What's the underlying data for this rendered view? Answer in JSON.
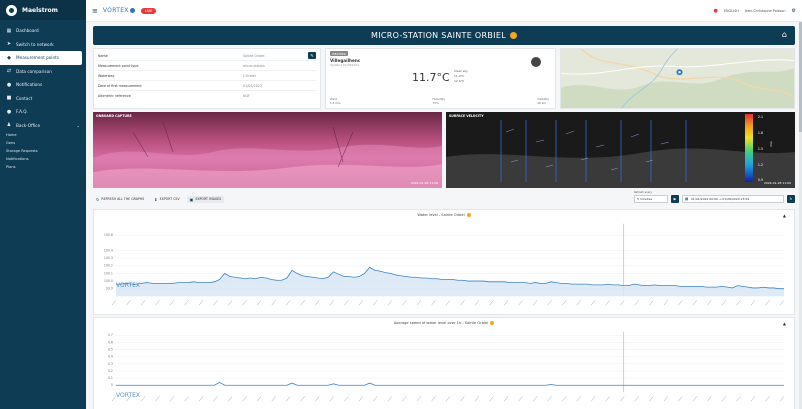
{
  "app": {
    "brand": "Maelstrom"
  },
  "sidebar": {
    "items": [
      {
        "label": "Dashboard",
        "icon": "grid-icon"
      },
      {
        "label": "Switch to network",
        "icon": "arrow-icon"
      },
      {
        "label": "Measurement points",
        "icon": "pin-icon"
      },
      {
        "label": "Data comparison",
        "icon": "compare-icon"
      },
      {
        "label": "Notifications",
        "icon": "bell-icon"
      },
      {
        "label": "Contact",
        "icon": "mail-icon"
      },
      {
        "label": "F.A.Q.",
        "icon": "help-icon"
      },
      {
        "label": "Back-Office",
        "icon": "settings-icon"
      }
    ],
    "sub_items": [
      "Home",
      "Gens",
      "Storage Requests",
      "Notifications",
      "Plans"
    ]
  },
  "topbar": {
    "logo_text": "VORTEX",
    "live_badge": "LIVE",
    "lang": "ENGLISH",
    "user": "Jean-Christophe Poisson"
  },
  "station": {
    "title": "MICRO-STATION SAINTE ORBIEL"
  },
  "info": {
    "rows": [
      {
        "key": "Name",
        "value": "Sainte Orbiel"
      },
      {
        "key": "Measurement point type",
        "value": "micro-station"
      },
      {
        "key": "Waterway",
        "value": "L'Orbiel"
      },
      {
        "key": "Date of first measurement",
        "value": "01/05/2023"
      },
      {
        "key": "Altimetric reference",
        "value": "NGF"
      }
    ]
  },
  "weather": {
    "tag": "WEATHER",
    "city": "Villegailhenc",
    "date": "Updated 01/28/2024",
    "temperature": "11.7°C",
    "condition_lines": [
      "Clear sky",
      "11.0°C",
      "12.0°C"
    ],
    "footer": [
      {
        "label": "Wind",
        "value": "1.5 m/s"
      },
      {
        "label": "Humidity",
        "value": "75%"
      },
      {
        "label": "Visibility",
        "value": "10 km"
      }
    ]
  },
  "media": {
    "cam_label": "ONBOARD CAPTURE",
    "cam_timestamp": "2024-01-28 11:00",
    "vel_label": "SURFACE VELOCITY",
    "vel_timestamp": "2024-01-28 11:00",
    "scale": [
      "2.1",
      "1.8",
      "1.5",
      "1.2",
      "0.9"
    ],
    "scale_unit": "m/s"
  },
  "toolbar": {
    "refresh": "REFRESH ALL THE GRAPHS",
    "export_csv": "EXPORT CSV",
    "export_images": "EXPORT IMAGES",
    "refresh_every_label": "Refresh every",
    "refresh_every_value": "5 minutes",
    "date_range": "01/01/2024 00:00 → 01/28/2024 23:59"
  },
  "chart_data": [
    {
      "type": "area",
      "title": "Water level - Sainte Orbiel",
      "ylim": [
        99.8,
        100.75
      ],
      "y_ticks": [
        "100.6",
        "100.4",
        "100.3",
        "100.2",
        "100.1",
        "100.0",
        "99.9"
      ],
      "values": [
        99.96,
        99.96,
        99.97,
        99.96,
        99.96,
        99.97,
        99.98,
        99.97,
        99.97,
        99.97,
        99.97,
        99.97,
        99.98,
        99.98,
        99.98,
        99.99,
        99.98,
        99.98,
        99.98,
        99.99,
        100.02,
        100.1,
        100.06,
        100.05,
        100.04,
        100.03,
        100.04,
        100.03,
        100.05,
        100.04,
        100.02,
        100.01,
        100.01,
        100.04,
        100.14,
        100.1,
        100.07,
        100.06,
        100.05,
        100.04,
        100.03,
        100.05,
        100.12,
        100.09,
        100.06,
        100.06,
        100.05,
        100.06,
        100.1,
        100.18,
        100.14,
        100.13,
        100.11,
        100.1,
        100.08,
        100.07,
        100.06,
        100.05,
        100.05,
        100.04,
        100.04,
        100.03,
        100.03,
        100.02,
        100.02,
        100.02,
        100.01,
        100.01,
        100.0,
        100.0,
        100.0,
        100.0,
        99.99,
        99.99,
        99.99,
        99.99,
        99.98,
        99.98,
        99.98,
        99.98,
        99.97,
        99.98,
        99.97,
        99.97,
        99.99,
        99.98,
        99.97,
        99.97,
        99.96,
        99.96,
        99.96,
        99.96,
        99.95,
        99.95,
        99.95,
        99.96,
        99.95,
        99.95,
        99.94,
        99.94,
        99.96,
        99.95,
        99.94,
        99.94,
        99.95,
        99.94,
        99.94,
        99.94,
        99.94,
        99.93,
        99.93,
        99.93,
        99.93,
        99.93,
        99.92,
        99.92,
        99.92,
        99.93,
        99.92,
        99.91,
        99.94,
        99.93,
        99.92,
        99.91,
        99.91,
        99.92,
        99.91,
        99.91,
        99.9,
        99.9
      ]
    },
    {
      "type": "line",
      "title": "Average speed of water level over 1h - Sainte Orbiel",
      "ylim": [
        -0.1,
        0.75
      ],
      "y_ticks": [
        "0.7",
        "0.6",
        "0.5",
        "0.4",
        "0.3",
        "0.2",
        "0.1",
        "0"
      ],
      "values": [
        0,
        0,
        0,
        0,
        0,
        0,
        0,
        0,
        0,
        0,
        0,
        0,
        0,
        0,
        0,
        0,
        0,
        0,
        0,
        0,
        0.04,
        0,
        0,
        0,
        0,
        0,
        0,
        0,
        0,
        0,
        0,
        0,
        0,
        0,
        0.03,
        0,
        0,
        0,
        0,
        0,
        0,
        0,
        0.02,
        0,
        0,
        0,
        0,
        0,
        0,
        0.03,
        0,
        0,
        0,
        0,
        0,
        0,
        0,
        0,
        0,
        0,
        0,
        0,
        0,
        0,
        0,
        0,
        0,
        0,
        0,
        0,
        0,
        0,
        0,
        0,
        0,
        0,
        0,
        0,
        0,
        0,
        0,
        0,
        0,
        0,
        0.01,
        0,
        0,
        0,
        0,
        0,
        0,
        0,
        0,
        0,
        0,
        0,
        0,
        0,
        0,
        0,
        0,
        0,
        0,
        0,
        0,
        0,
        0,
        0,
        0,
        0,
        0,
        0,
        0,
        0,
        0,
        0,
        0,
        0,
        0,
        0,
        0,
        0,
        0,
        0,
        0,
        0,
        0,
        0,
        0,
        0
      ]
    }
  ]
}
